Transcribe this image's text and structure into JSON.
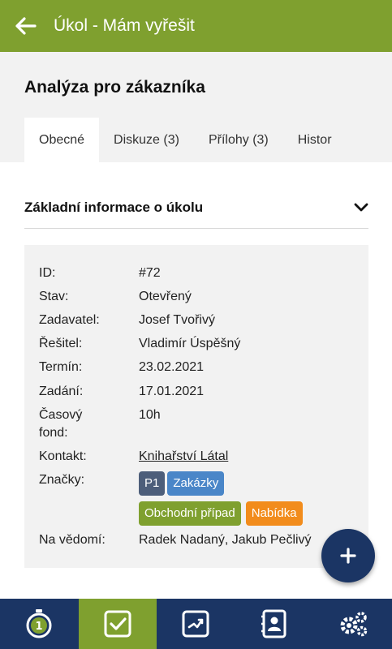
{
  "appbar": {
    "title": "Úkol - Mám vyřešit",
    "back_icon": "arrow-left-icon"
  },
  "task": {
    "title": "Analýza pro zákazníka"
  },
  "tabs": [
    {
      "label": "Obecné",
      "active": true
    },
    {
      "label": "Diskuze (3)",
      "active": false
    },
    {
      "label": "Přílohy (3)",
      "active": false
    },
    {
      "label": "Histor",
      "active": false
    }
  ],
  "section": {
    "title": "Základní informace o úkolu",
    "toggle_icon": "chevron-down-icon"
  },
  "details": {
    "id": {
      "label": "ID:",
      "value": "#72"
    },
    "stav": {
      "label": "Stav:",
      "value": "Otevřený"
    },
    "zadavatel": {
      "label": "Zadavatel:",
      "value": "Josef Tvořivý"
    },
    "resitel": {
      "label": "Řešitel:",
      "value": "Vladimír Úspěšný"
    },
    "termin": {
      "label": "Termín:",
      "value": "23.02.2021"
    },
    "zadani": {
      "label": "Zadání:",
      "value": "17.01.2021"
    },
    "casovy_fond": {
      "label1": "Časový",
      "label2": "fond:",
      "value": "10h"
    },
    "kontakt": {
      "label": "Kontakt:",
      "value": "Knihařství Látal"
    },
    "znacky": {
      "label": "Značky:",
      "tags": [
        {
          "text": "P1",
          "color": "#4d5e7a"
        },
        {
          "text": "Zakázky",
          "color": "#4a86c8"
        },
        {
          "text": "Obchodní případ",
          "color": "#7fa02f"
        },
        {
          "text": "Nabídka",
          "color": "#f28c1c"
        }
      ]
    },
    "na_vedomi": {
      "label": "Na vědomí:",
      "value": "Radek Nadaný, Jakub Pečlivý"
    }
  },
  "fab": {
    "icon": "plus-icon"
  },
  "bottom_nav": [
    {
      "icon": "stopwatch-icon",
      "badge": "1"
    },
    {
      "icon": "checkbox-icon",
      "active": true
    },
    {
      "icon": "workflow-icon"
    },
    {
      "icon": "contacts-book-icon"
    },
    {
      "icon": "settings-gears-icon"
    }
  ],
  "colors": {
    "primary_green": "#7fa02f",
    "navy": "#1b3564",
    "link": "#2a5aa5"
  }
}
